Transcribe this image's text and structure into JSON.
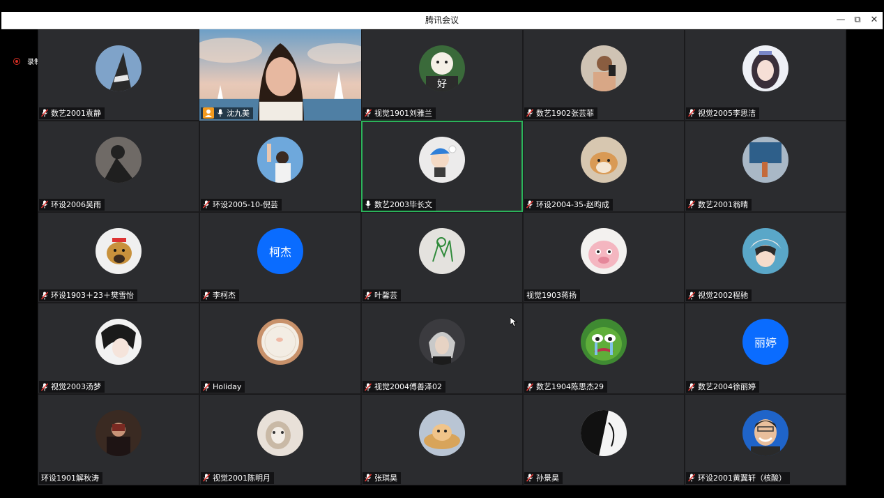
{
  "window": {
    "title": "腾讯会议",
    "minimize_icon": "—",
    "restore_icon": "⧉",
    "close_icon": "✕"
  },
  "recording": {
    "label": "录制中",
    "color": "#d93025"
  },
  "colors": {
    "text_avatar_bg": "#0a6cff",
    "active_border": "#2bb35a",
    "host_badge": "#f39a1e"
  },
  "participants": [
    {
      "name": "数艺2001袁静",
      "mic": "muted",
      "avatar": "cone"
    },
    {
      "name": "沈九美",
      "mic": "on",
      "host": true,
      "video": true
    },
    {
      "name": "视觉1901刘雅兰",
      "mic": "muted",
      "avatar": "好"
    },
    {
      "name": "数艺1902张芸菲",
      "mic": "muted",
      "avatar": "selfie"
    },
    {
      "name": "视觉2005李思洁",
      "mic": "muted",
      "avatar": "anime-girl"
    },
    {
      "name": "环设2006吴雨",
      "mic": "muted",
      "avatar": "dark-figure"
    },
    {
      "name": "环设2005-10-倪芸",
      "mic": "muted",
      "avatar": "sky-person"
    },
    {
      "name": "数艺2003毕长文",
      "mic": "on",
      "avatar": "cartoon-boy",
      "active": true
    },
    {
      "name": "环设2004-35-赵昀成",
      "mic": "muted",
      "avatar": "shiba"
    },
    {
      "name": "数艺2001翁晴",
      "mic": "muted",
      "avatar": "street"
    },
    {
      "name": "环设1903＋23＋樊雪怡",
      "mic": "muted",
      "avatar": "dog-snow"
    },
    {
      "name": "李柯杰",
      "mic": "muted",
      "avatar_text": "柯杰"
    },
    {
      "name": "叶馨芸",
      "mic": "muted",
      "avatar": "drawing"
    },
    {
      "name": "视觉1903蒋扬",
      "mic": "none",
      "avatar": "pink-bunny"
    },
    {
      "name": "视觉2002程驰",
      "mic": "muted",
      "avatar": "anime-boy"
    },
    {
      "name": "视觉2003汤梦",
      "mic": "muted",
      "avatar": "anime-dark"
    },
    {
      "name": "Holiday",
      "mic": "muted",
      "avatar": "plate"
    },
    {
      "name": "视觉2004傅善泽02",
      "mic": "muted",
      "avatar": "silver-hair"
    },
    {
      "name": "数艺1904陈思杰29",
      "mic": "muted",
      "avatar": "pepe"
    },
    {
      "name": "数艺2004徐丽婷",
      "mic": "muted",
      "avatar_text": "丽婷"
    },
    {
      "name": "环设1901解秋涛",
      "mic": "none",
      "avatar": "dark-room"
    },
    {
      "name": "视觉2001陈明月",
      "mic": "muted",
      "avatar": "cat"
    },
    {
      "name": "张琪昊",
      "mic": "muted",
      "avatar": "cat-basket"
    },
    {
      "name": "孙景昊",
      "mic": "muted",
      "avatar": "manga"
    },
    {
      "name": "环设2001黄翼轩（核酸）",
      "mic": "muted",
      "avatar": "smiling-man"
    }
  ]
}
